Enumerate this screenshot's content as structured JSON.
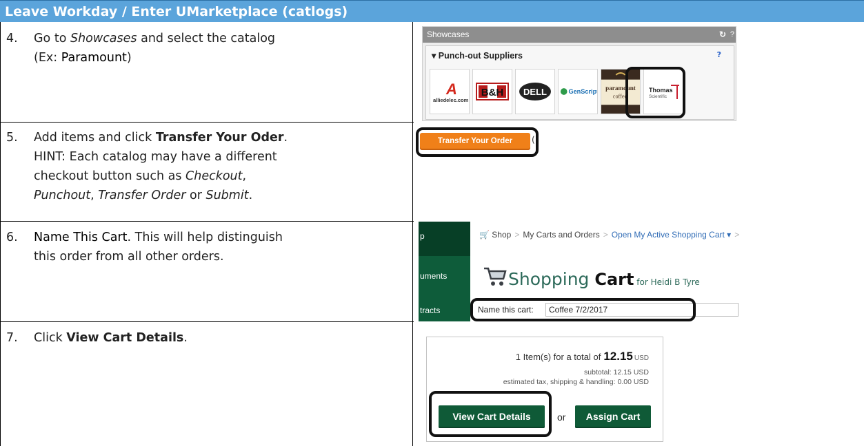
{
  "header": {
    "title": "Leave Workday / Enter UMarketplace (catlogs)"
  },
  "steps": [
    {
      "num": "4.",
      "line1_a": "Go to ",
      "line1_i": "Showcases",
      "line1_b": " and select the catalog",
      "line2_a": "(Ex: ",
      "line2_highlight": "Paramount",
      "line2_b": ")"
    },
    {
      "num": "5.",
      "line1_a": "Add items and click ",
      "line1_bold": "Transfer Your  Oder",
      "line1_b": ".",
      "line2": "HINT: Each catalog may have a different",
      "line3_a": "checkout button such as ",
      "line3_i": "Checkout",
      "line3_b": ",",
      "line4_i1": "Punchout",
      "line4_a": ", ",
      "line4_i2": "Transfer Order",
      "line4_b": " or ",
      "line4_i3": "Submit",
      "line4_c": "."
    },
    {
      "num": "6.",
      "line1_highlight": "Name This Cart",
      "line1_a": ". This will help distinguish",
      "line2": "this order from all other orders."
    },
    {
      "num": "7.",
      "line1_a": "Click ",
      "line1_bold": "View Cart Details",
      "line1_b": "."
    }
  ],
  "showcases": {
    "title": "Showcases",
    "refresh_icon": "↻",
    "cut_text": "?",
    "section_title": "▾ Punch-out Suppliers",
    "help": "?",
    "suppliers": [
      {
        "name": "alliedelec.com",
        "mark": "A"
      },
      {
        "name": "B&H",
        "mark": "B&H"
      },
      {
        "name": "DELL",
        "mark": "DELL"
      },
      {
        "name": "GenScript",
        "mark": "GenScript"
      },
      {
        "name": "paramount coffee",
        "mark": "paramount"
      },
      {
        "name": "Thomas Scientific",
        "mark": "Thomas"
      }
    ]
  },
  "transfer": {
    "button_label": "Transfer Your Order",
    "cut_text": "("
  },
  "cart": {
    "sidebar": {
      "top": "p",
      "item1": "uments",
      "item2": "tracts"
    },
    "breadcrumb": {
      "shop": "Shop",
      "carts": "My Carts and Orders",
      "active": "Open My Active Shopping Cart ▾",
      "more": ">"
    },
    "title_a": "Shopping ",
    "title_b": "Cart",
    "title_for": " for Heidi B Tyre",
    "name_label": "Name this cart:",
    "name_value": "Coffee 7/2/2017"
  },
  "totals": {
    "items_text": "1 Item(s)  for a total of",
    "total": "12.15",
    "currency": "USD",
    "subtotal": "subtotal:  12.15 USD",
    "tax": "estimated tax, shipping & handling:   0.00 USD",
    "view_button": "View Cart Details",
    "or": "or",
    "assign_button": "Assign Cart"
  },
  "colors": {
    "header_bg": "#5ba4db",
    "orange": "#f08019",
    "green": "#0f5a37"
  }
}
